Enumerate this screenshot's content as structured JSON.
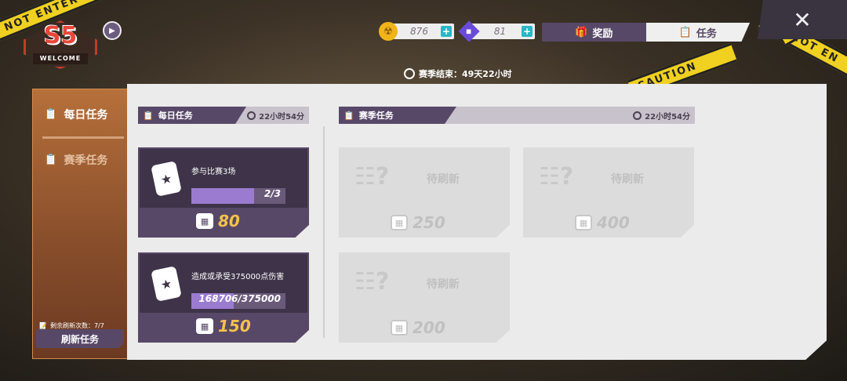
{
  "header": {
    "logo_text": "S5",
    "logo_sub": "WELCOME",
    "gold": "876",
    "gems": "81",
    "tab_rewards": "奖励",
    "tab_tasks": "任务",
    "close": "✕",
    "season_end": "赛季结束：49天22小时"
  },
  "sidebar": {
    "items": [
      {
        "label": "每日任务"
      },
      {
        "label": "赛季任务"
      }
    ],
    "refresh_note": "剩余刷新次数：7/7",
    "refresh_button": "刷新任务"
  },
  "daily": {
    "title": "每日任务",
    "time": "22小时54分",
    "cards": [
      {
        "desc": "参与比赛3场",
        "progress": "2/3",
        "progress_fraction": 0.67,
        "reward": "80"
      },
      {
        "desc": "造成或承受375000点伤害",
        "progress": "168706/375000",
        "progress_fraction": 0.45,
        "reward": "150"
      }
    ]
  },
  "season": {
    "title": "赛季任务",
    "time": "22小时54分",
    "cards": [
      {
        "status": "待刷新",
        "reward": "250"
      },
      {
        "status": "待刷新",
        "reward": "400"
      },
      {
        "status": "待刷新",
        "reward": "200"
      }
    ]
  }
}
